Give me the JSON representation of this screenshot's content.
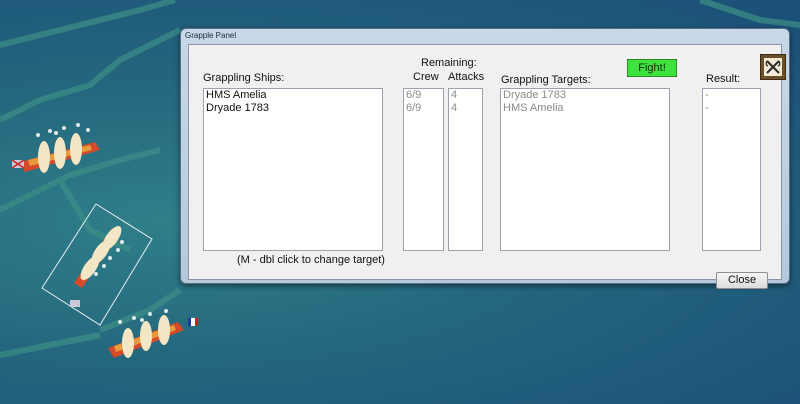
{
  "window": {
    "title": "Grapple Panel"
  },
  "headers": {
    "remaining": "Remaining:",
    "crew": "Crew",
    "attacks": "Attacks",
    "grappling_ships": "Grappling Ships:",
    "grappling_targets": "Grappling Targets:",
    "result": "Result:"
  },
  "ships": [
    {
      "name": "HMS Amelia",
      "crew": "6/9",
      "attacks": "4",
      "target": "Dryade 1783",
      "result": "-"
    },
    {
      "name": "Dryade 1783",
      "crew": "6/9",
      "attacks": "4",
      "target": "HMS Amelia",
      "result": "-"
    }
  ],
  "buttons": {
    "fight": "Fight!",
    "close": "Close"
  },
  "hint": "(M - dbl click to change target)",
  "icons": {
    "grapple": "crossed-hooks-icon"
  },
  "colors": {
    "fight_button": "#3ee23e",
    "sea": "#24667d",
    "panel_frame": "#c9d8e8"
  }
}
